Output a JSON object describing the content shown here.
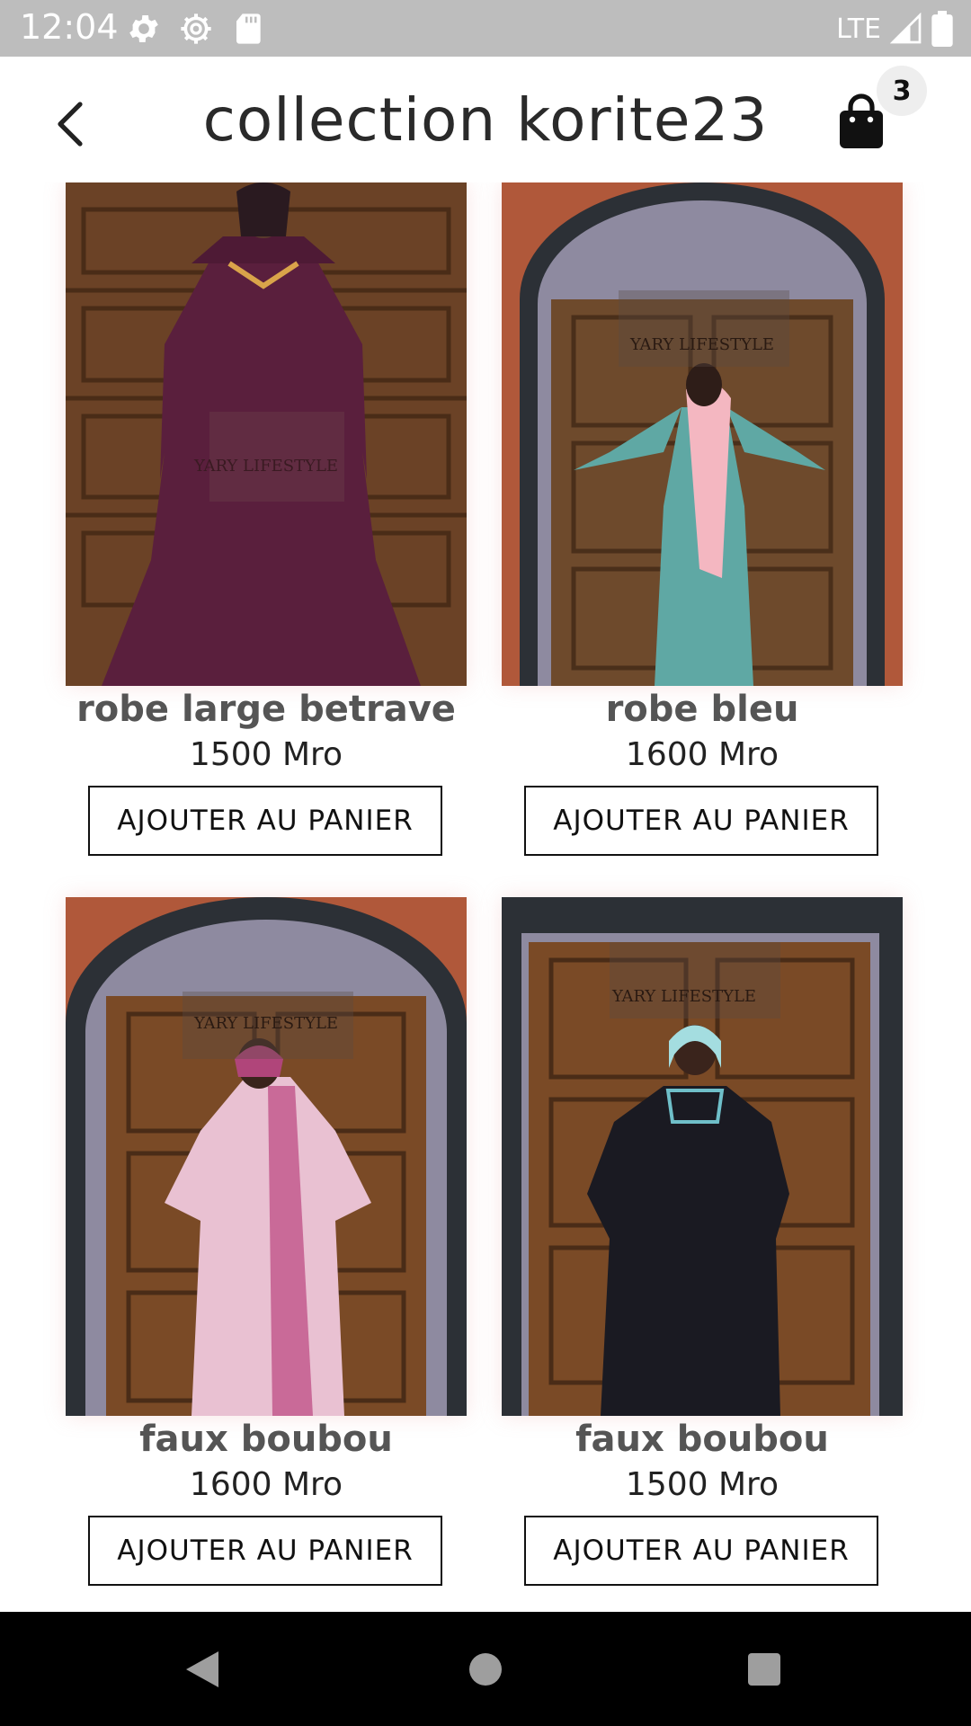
{
  "status_bar": {
    "time": "12:04",
    "network": "LTE"
  },
  "header": {
    "title": "collection korite23",
    "cart_count": "3"
  },
  "products": [
    {
      "name": "robe large betrave",
      "price": "1500 Mro",
      "button": "AJOUTER AU PANIER",
      "watermark": "YARY LIFESTYLE",
      "dress_color": "#5a1f3d"
    },
    {
      "name": "robe bleu",
      "price": "1600 Mro",
      "button": "AJOUTER AU PANIER",
      "watermark": "YARY LIFESTYLE",
      "dress_color": "#5fa8a4"
    },
    {
      "name": "faux boubou",
      "price": "1600 Mro",
      "button": "AJOUTER AU PANIER",
      "watermark": "YARY LIFESTYLE",
      "dress_color": "#c97aa8"
    },
    {
      "name": "faux boubou",
      "price": "1500 Mro",
      "button": "AJOUTER AU PANIER",
      "watermark": "YARY LIFESTYLE",
      "dress_color": "#1a1a22"
    }
  ],
  "colors": {
    "status_bar": "#bdbdbd",
    "nav_bar": "#000000",
    "wood": "#7a4a26"
  }
}
